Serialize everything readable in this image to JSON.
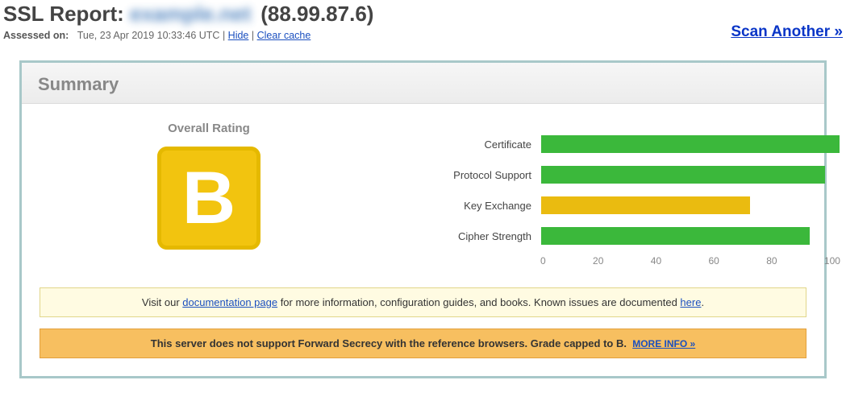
{
  "header": {
    "title_prefix": "SSL Report:",
    "domain_placeholder": "example.net",
    "ip": "(88.99.87.6)",
    "assessed_label": "Assessed on:",
    "assessed_value": "Tue, 23 Apr 2019 10:33:46 UTC",
    "separator": " | ",
    "hide": "Hide",
    "clear_cache": "Clear cache",
    "scan_another": "Scan Another »"
  },
  "summary": {
    "heading": "Summary",
    "rating_caption": "Overall Rating",
    "grade": "B",
    "grade_color": "#f2c40f"
  },
  "chart_data": {
    "type": "bar",
    "title": "",
    "xlabel": "",
    "ylabel": "",
    "xlim": [
      0,
      100
    ],
    "ticks": [
      0,
      20,
      40,
      60,
      80,
      100
    ],
    "categories": [
      "Certificate",
      "Protocol Support",
      "Key Exchange",
      "Cipher Strength"
    ],
    "values": [
      100,
      95,
      70,
      90
    ],
    "colors": [
      "#3bb83b",
      "#3bb83b",
      "#eabb10",
      "#3bb83b"
    ]
  },
  "notices": {
    "docs_pre": "Visit our ",
    "docs_link": "documentation page",
    "docs_mid": " for more information, configuration guides, and books. Known issues are documented ",
    "docs_here": "here",
    "docs_post": ".",
    "fs_text": "This server does not support Forward Secrecy with the reference browsers. Grade capped to B.",
    "fs_more": "MORE INFO »"
  }
}
